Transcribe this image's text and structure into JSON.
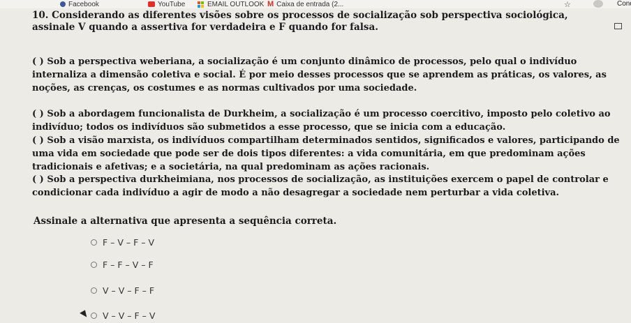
{
  "bookmarks": [
    {
      "label": "Facebook",
      "icon": "facebook-icon"
    },
    {
      "label": "YouTube",
      "icon": "youtube-icon"
    },
    {
      "label": "EMAIL OUTLOOK",
      "icon": "microsoft-icon"
    },
    {
      "label": "Caixa de entrada (2...",
      "icon": "gmail-icon"
    }
  ],
  "profile_label": "Cond",
  "question": {
    "title": "10. Considerando as diferentes visões sobre os processos de socialização sob perspectiva sociológica, assinale V quando a assertiva for verdadeira e F quando for falsa.",
    "statements": [
      "( ) Sob a perspectiva weberiana, a socialização é um conjunto dinâmico de processos, pelo qual o indivíduo internaliza a dimensão coletiva e social. É por meio desses processos que se aprendem as práticas, os valores, as noções, as crenças, os costumes e as normas cultivados por uma sociedade.",
      "( ) Sob a abordagem funcionalista de Durkheim, a socialização é um processo coercitivo, imposto pelo coletivo ao indivíduo; todos os indivíduos são submetidos a esse processo, que se inicia com a educação.",
      "( ) Sob a visão marxista, os indivíduos compartilham determinados sentidos, significados e valores, participando de uma vida em sociedade que pode ser de dois tipos diferentes: a vida comunitária, em que predominam ações tradicionais e afetivas; e a societária, na qual predominam as ações racionais.",
      "( ) Sob a perspectiva durkheimiana, nos processos de socialização, as instituições exercem o papel de controlar e condicionar cada indivíduo a agir de modo a não desagregar a sociedade nem perturbar a vida coletiva."
    ],
    "instruction": "Assinale a alternativa que apresenta a sequência correta.",
    "options": [
      "F – V – F – V",
      "F – F – V – F",
      "V – V – F – F",
      "V – V – F – V"
    ]
  }
}
